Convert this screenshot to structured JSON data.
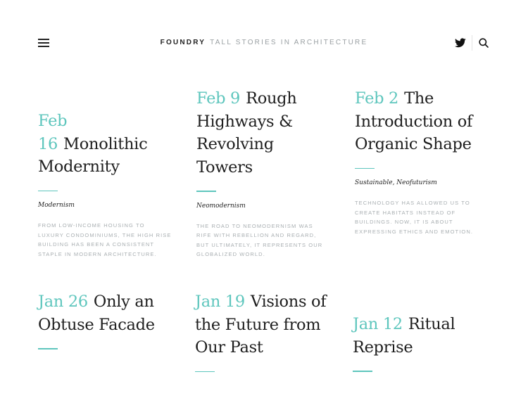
{
  "header": {
    "brand_name": "FOUNDRY",
    "tagline": "TALL STORIES IN ARCHITECTURE",
    "icons": {
      "menu": "hamburger-menu-icon",
      "social": "twitter-icon",
      "search": "search-icon"
    }
  },
  "colors": {
    "accent": "#5ec6bd",
    "text": "#1e1e1e",
    "muted": "#a8aeb1"
  },
  "posts": [
    {
      "date": "Feb 16",
      "title": "Monolithic Modernity",
      "category": "Modernism",
      "excerpt": "From low-income housing to luxury condominiums, the high rise building has been a consistent staple in modern architecture."
    },
    {
      "date": "Feb 9",
      "title": "Rough Highways & Revolving Towers",
      "category": "Neomodernism",
      "excerpt": "The road to neomodernism was rife with rebellion and regard, but ultimately, it represents our globalized world."
    },
    {
      "date": "Feb 2",
      "title": "The Introduction of Organic Shape",
      "category": "Sustainable, Neofuturism",
      "excerpt": "Technology has allowed us to create habitats instead of buildings. Now, it is about expressing ethics and emotion."
    },
    {
      "date": "Jan 26",
      "title": "Only an Obtuse Facade"
    },
    {
      "date": "Jan 19",
      "title": "Visions of the Future from Our Past"
    },
    {
      "date": "Jan 12",
      "title": "Ritual Reprise"
    }
  ]
}
